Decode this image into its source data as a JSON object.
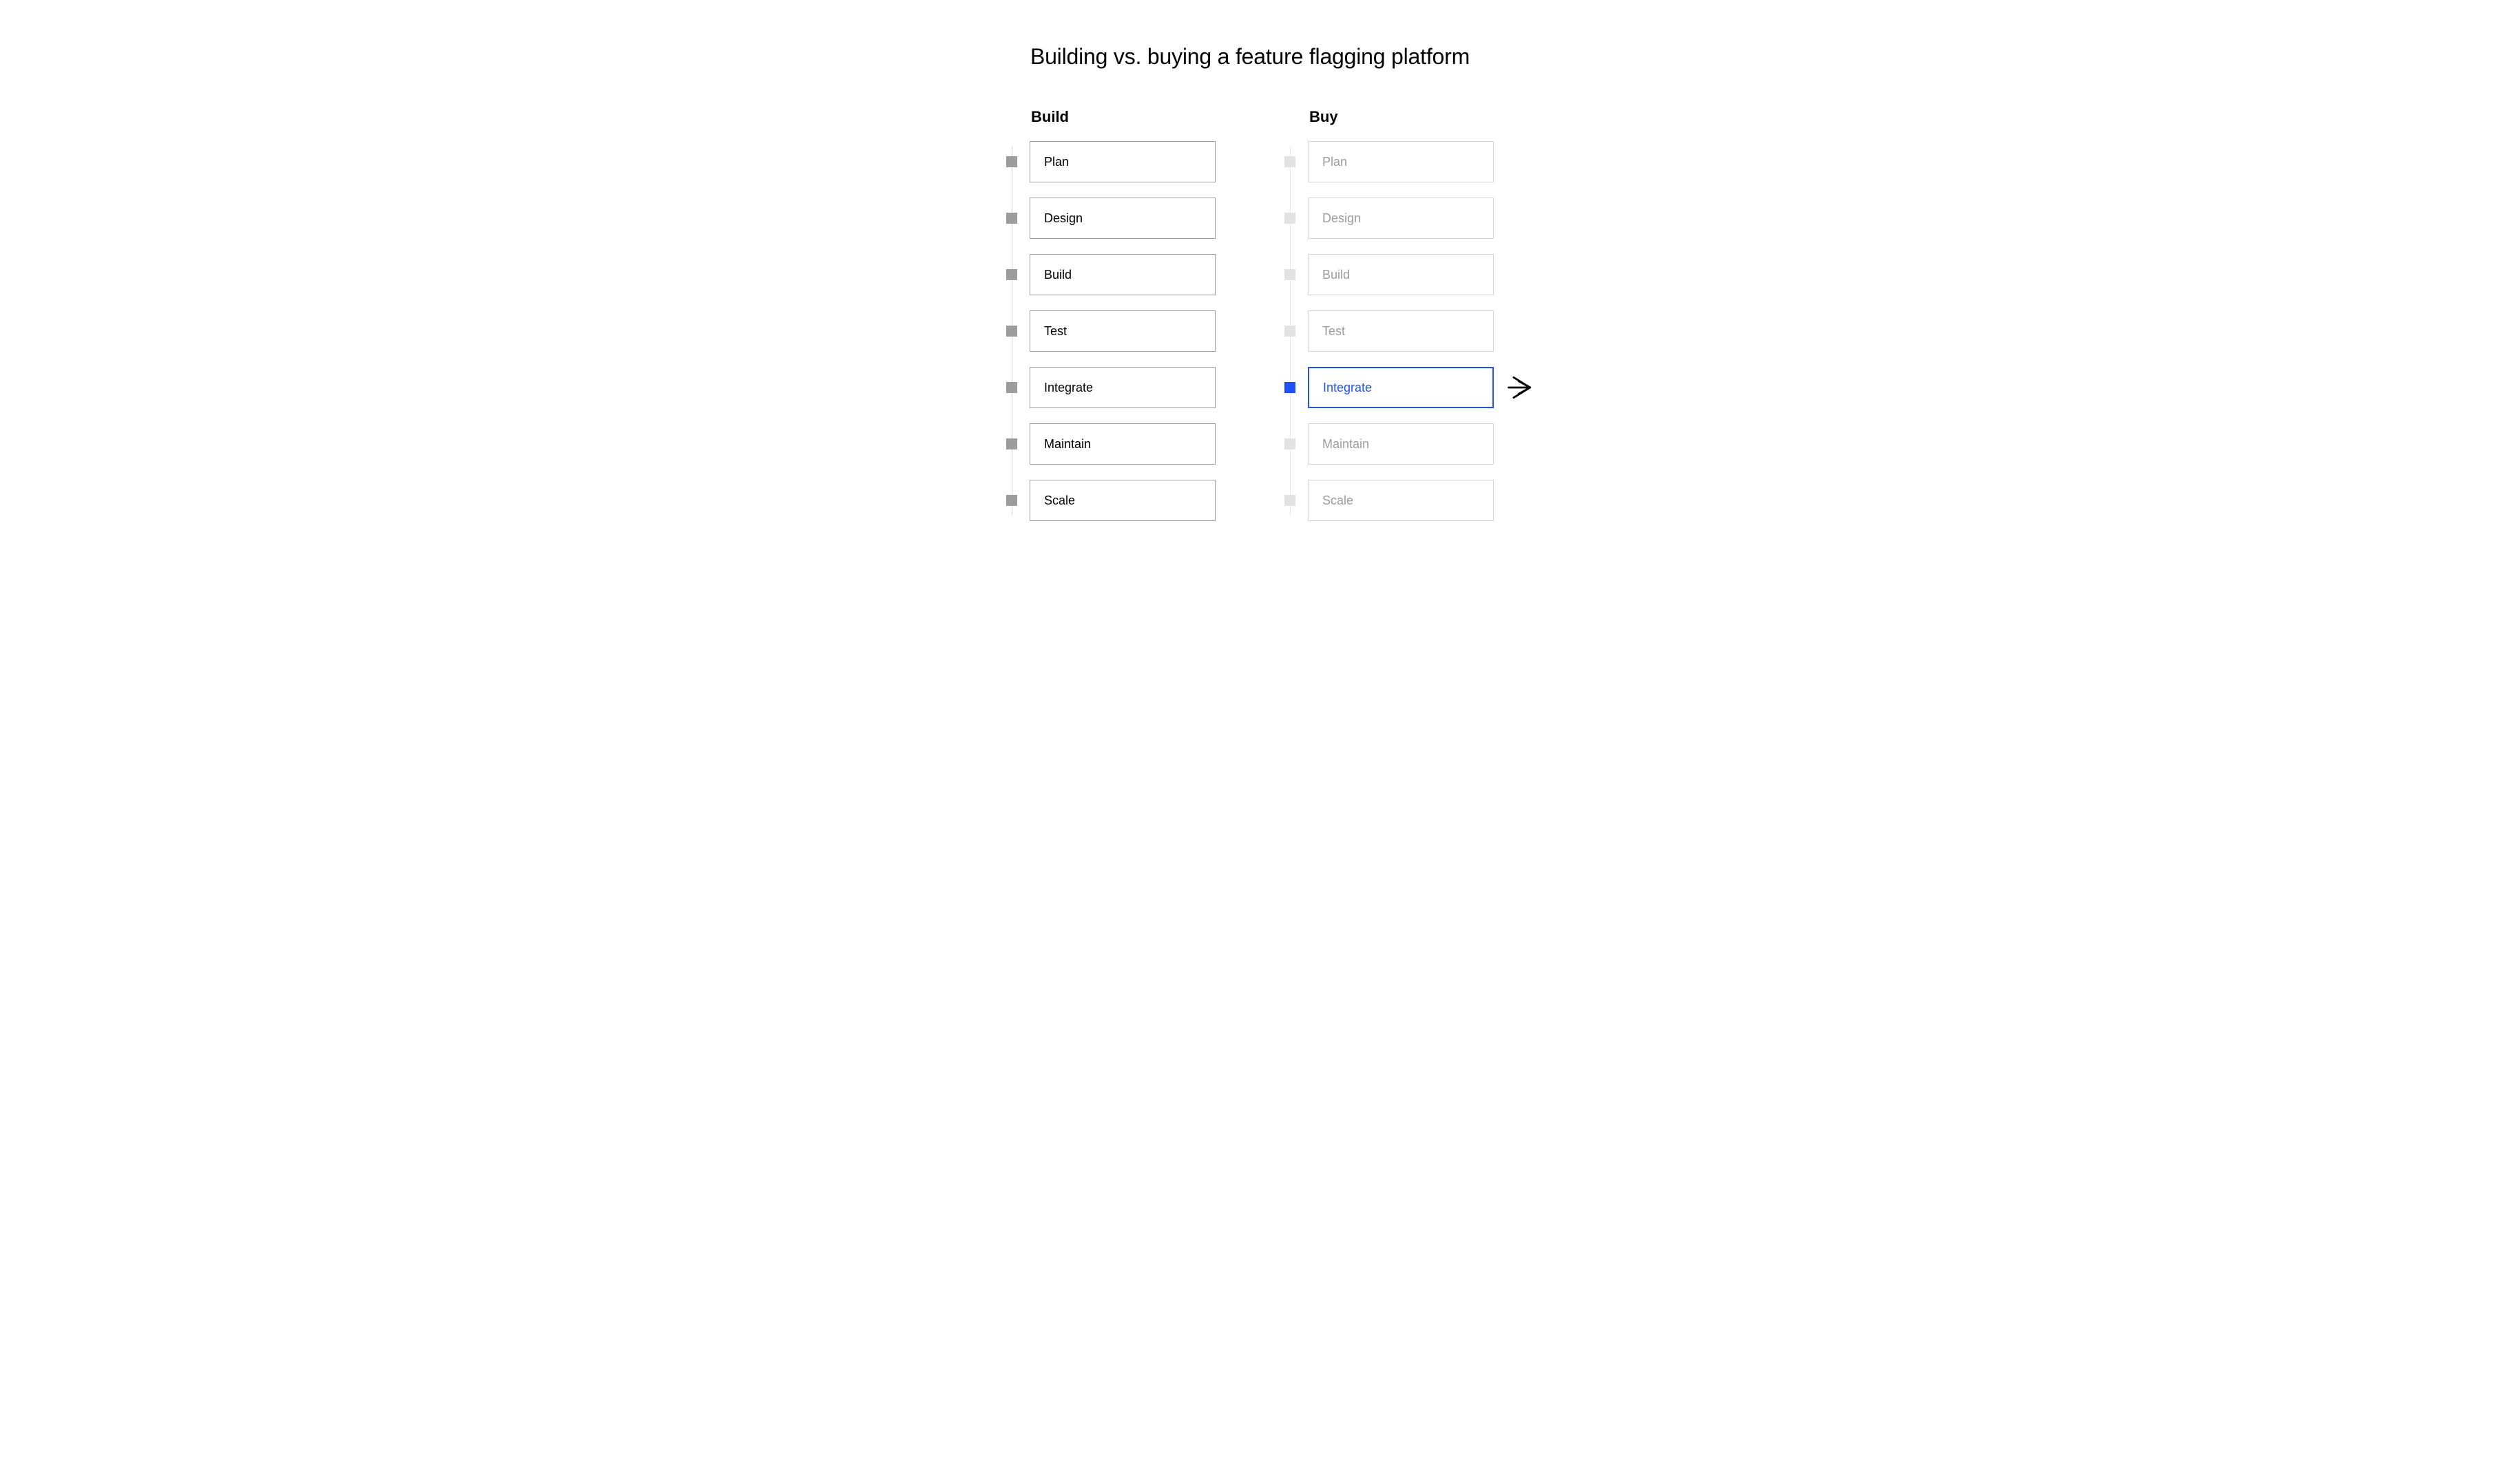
{
  "title": "Building vs. buying a feature flagging platform",
  "columns": {
    "build": {
      "header": "Build",
      "steps": [
        "Plan",
        "Design",
        "Build",
        "Test",
        "Integrate",
        "Maintain",
        "Scale"
      ]
    },
    "buy": {
      "header": "Buy",
      "steps": [
        "Plan",
        "Design",
        "Build",
        "Test",
        "Integrate",
        "Maintain",
        "Scale"
      ],
      "highlight_index": 4
    }
  },
  "colors": {
    "accent": "#1f4fff",
    "muted": "#9c9c9c",
    "faded": "#e2e2e2",
    "border_faded": "#d5d5d5"
  }
}
